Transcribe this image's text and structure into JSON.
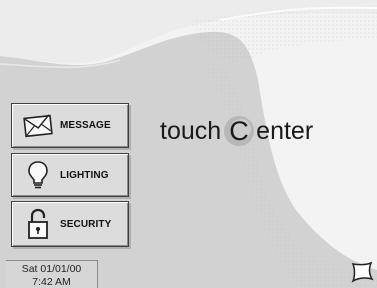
{
  "menu": {
    "message_label": "MESSAGE",
    "lighting_label": "LIGHTING",
    "security_label": "SECURITY",
    "message_icon": "envelope-icon",
    "lighting_icon": "lightbulb-icon",
    "security_icon": "padlock-icon"
  },
  "logo": {
    "prefix": "touch",
    "letter": "C",
    "suffix": "enter"
  },
  "status": {
    "date": "Sat 01/01/00",
    "time": "7:42 AM"
  },
  "corner": {
    "icon": "star-outline-icon"
  },
  "colors": {
    "background": "#f2f2f2",
    "wave": "#d0d0d0",
    "button_face": "#dcdcdc",
    "logo_accent": "#b3b3b3"
  }
}
